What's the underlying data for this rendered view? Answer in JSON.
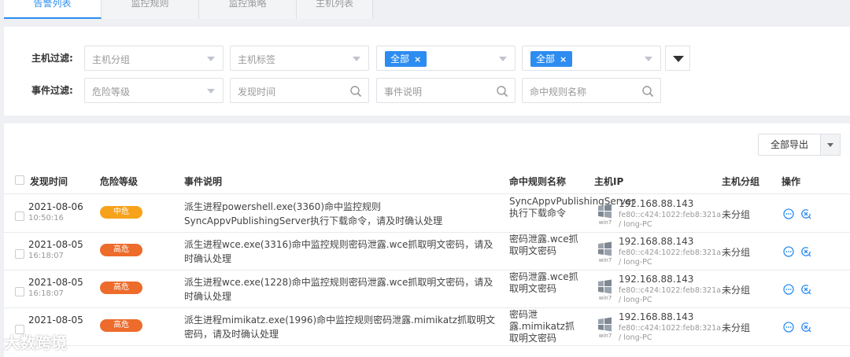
{
  "tabs": [
    {
      "label": "告警列表",
      "active": true
    },
    {
      "label": "监控规则",
      "active": false
    },
    {
      "label": "监控策略",
      "active": false
    },
    {
      "label": "主机列表",
      "active": false
    }
  ],
  "filters": {
    "host_label": "主机过滤:",
    "event_label": "事件过滤:",
    "host_group_placeholder": "主机分组",
    "host_tag_placeholder": "主机标签",
    "chip_1": "全部",
    "chip_2": "全部",
    "chip_remove": "×",
    "risk_placeholder": "危险等级",
    "time_placeholder": "发现时间",
    "event_desc_placeholder": "事件说明",
    "rule_name_placeholder": "命中规则名称"
  },
  "toolbar": {
    "export_label": "全部导出"
  },
  "columns": {
    "time": "发现时间",
    "risk": "危险等级",
    "desc": "事件说明",
    "rule": "命中规则名称",
    "ip": "主机IP",
    "group": "主机分组",
    "ops": "操作"
  },
  "rows": [
    {
      "date": "2021-08-06",
      "time": "10:50:16",
      "risk": "中危",
      "risk_color": "#f7a21b",
      "desc": "派生进程powershell.exe(3360)命中监控规则SyncAppvPublishingServer执行下载命令，请及时确认处理",
      "rule": "SyncAppvPublishingServer执行下载命令",
      "os": "win7",
      "ip": "192.168.88.143",
      "ipv6": "fe80::c424:1022:feb8:321a / long-PC",
      "group": "未分组"
    },
    {
      "date": "2021-08-05",
      "time": "16:18:07",
      "risk": "高危",
      "risk_color": "#ed6b2b",
      "desc": "派生进程wce.exe(3316)命中监控规则密码泄露.wce抓取明文密码，请及时确认处理",
      "rule": "密码泄露.wce抓取明文密码",
      "os": "win7",
      "ip": "192.168.88.143",
      "ipv6": "fe80::c424:1022:feb8:321a / long-PC",
      "group": "未分组"
    },
    {
      "date": "2021-08-05",
      "time": "16:18:07",
      "risk": "高危",
      "risk_color": "#ed6b2b",
      "desc": "派生进程wce.exe(1228)命中监控规则密码泄露.wce抓取明文密码，请及时确认处理",
      "rule": "密码泄露.wce抓取明文密码",
      "os": "win7",
      "ip": "192.168.88.143",
      "ipv6": "fe80::c424:1022:feb8:321a / long-PC",
      "group": "未分组"
    },
    {
      "date": "2021-08-05",
      "time": "",
      "risk": "高危",
      "risk_color": "#ed6b2b",
      "desc": "派生进程mimikatz.exe(1996)命中监控规则密码泄露.mimikatz抓取明文密码，请及时确认处理",
      "rule": "密码泄露.mimikatz抓取明文密码",
      "os": "win7",
      "ip": "192.168.88.143",
      "ipv6": "fe80::c424:1022:feb8:321a / long-PC",
      "group": "未分组"
    }
  ],
  "watermark": "大数跨境",
  "accent": "#2d8cf0"
}
